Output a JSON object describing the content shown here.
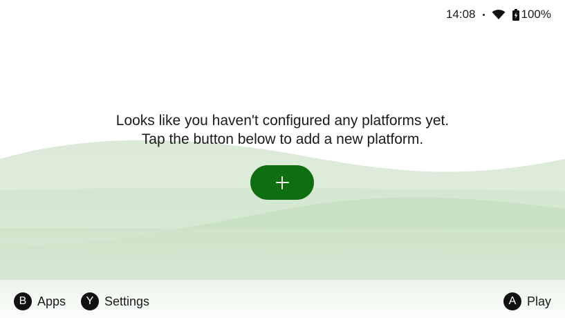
{
  "status_bar": {
    "time": "14:08",
    "wifi_icon": "wifi-icon",
    "battery_icon": "battery-charging-icon",
    "battery_percent": "100%"
  },
  "empty_state": {
    "line1": "Looks like you haven't configured any platforms yet.",
    "line2": "Tap the button below to add a new platform.",
    "add_button_icon": "plus-icon"
  },
  "bottom_hints": {
    "apps": {
      "badge": "B",
      "label": "Apps"
    },
    "settings": {
      "badge": "Y",
      "label": "Settings"
    },
    "play": {
      "badge": "A",
      "label": "Play"
    }
  },
  "colors": {
    "accent": "#0f6e0f",
    "wave_light": "#dcebd9",
    "wave_dark": "#c3ddbf",
    "background": "#ffffff"
  }
}
